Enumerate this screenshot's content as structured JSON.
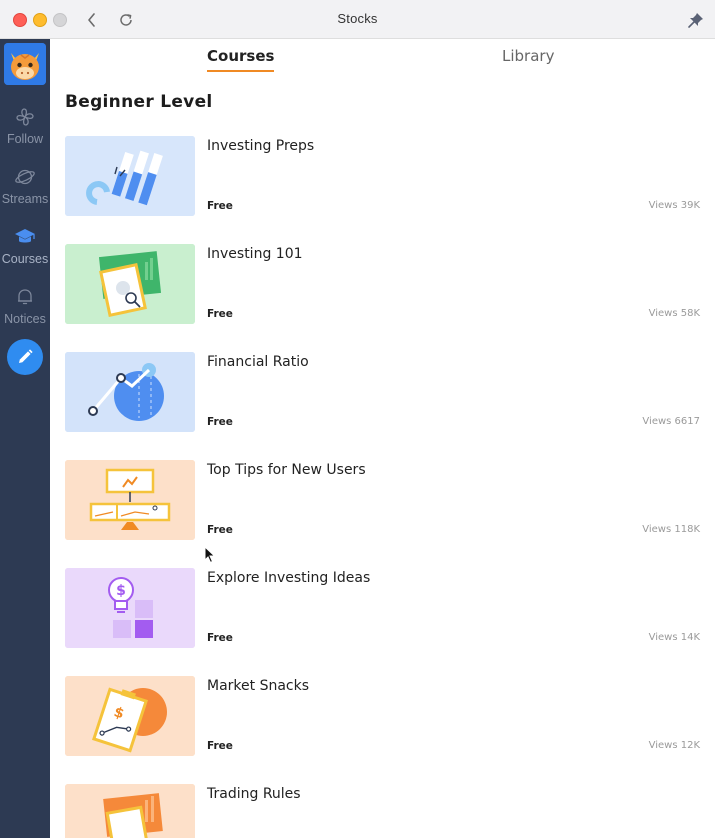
{
  "window": {
    "title": "Stocks"
  },
  "sidebar": {
    "items": [
      {
        "label": "Follow",
        "icon": "pinwheel-icon"
      },
      {
        "label": "Streams",
        "icon": "planet-icon"
      },
      {
        "label": "Courses",
        "icon": "graduation-cap-icon"
      },
      {
        "label": "Notices",
        "icon": "bell-icon"
      }
    ],
    "active": "Courses",
    "compose_icon": "pencil-icon"
  },
  "tabs": [
    {
      "label": "Courses",
      "active": true
    },
    {
      "label": "Library",
      "active": false
    }
  ],
  "section": {
    "title": "Beginner Level"
  },
  "courses": [
    {
      "name": "Investing Preps",
      "price": "Free",
      "views": "Views 39K",
      "thumb_color": "#d7e6fb"
    },
    {
      "name": "Investing 101",
      "price": "Free",
      "views": "Views 58K",
      "thumb_color": "#c9efcf"
    },
    {
      "name": "Financial Ratio",
      "price": "Free",
      "views": "Views 6617",
      "thumb_color": "#d3e3fa"
    },
    {
      "name": "Top Tips for New Users",
      "price": "Free",
      "views": "Views 118K",
      "thumb_color": "#fde0c9"
    },
    {
      "name": "Explore Investing Ideas",
      "price": "Free",
      "views": "Views 14K",
      "thumb_color": "#ead9fb"
    },
    {
      "name": "Market Snacks",
      "price": "Free",
      "views": "Views 12K",
      "thumb_color": "#fde0c9"
    },
    {
      "name": "Trading Rules",
      "price": "",
      "views": "",
      "thumb_color": "#fde0c9"
    }
  ],
  "colors": {
    "sidebar_bg": "#2d3a53",
    "accent_orange": "#f08a24",
    "compose_blue": "#2f8cf0"
  }
}
